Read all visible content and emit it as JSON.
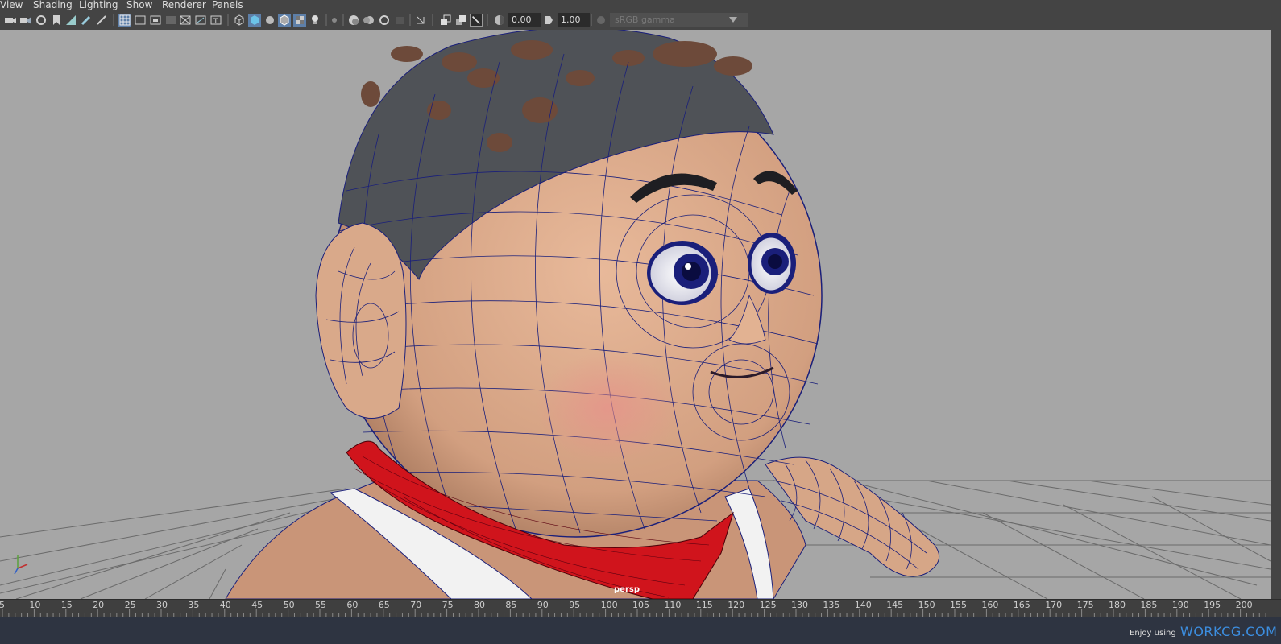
{
  "menu": [
    "View",
    "Shading",
    "Lighting",
    "Show",
    "Renderer",
    "Panels"
  ],
  "toolbar": {
    "exposure_value": "0.00",
    "gamma_value": "1.00",
    "color_space": "sRGB gamma"
  },
  "viewport": {
    "camera_label": "persp"
  },
  "timeline": {
    "ticks": [
      "5",
      "10",
      "15",
      "20",
      "25",
      "30",
      "35",
      "40",
      "45",
      "50",
      "55",
      "60",
      "65",
      "70",
      "75",
      "80",
      "85",
      "90",
      "95",
      "100",
      "105",
      "110",
      "115",
      "120",
      "125",
      "130",
      "135",
      "140",
      "145",
      "150",
      "155",
      "160",
      "165",
      "170",
      "175",
      "180",
      "185",
      "190",
      "195",
      "200"
    ]
  },
  "status": {
    "enjoy_text": "Enjoy using",
    "brand_text": "WORKCG.COM"
  },
  "colors": {
    "viewport_bg": "#a6a6a6",
    "wire": "#1a1f7a",
    "skin": "#d9a98a",
    "scarf": "#d0141c",
    "hair": "#4a4d52",
    "accent": "#3c8ee0"
  }
}
